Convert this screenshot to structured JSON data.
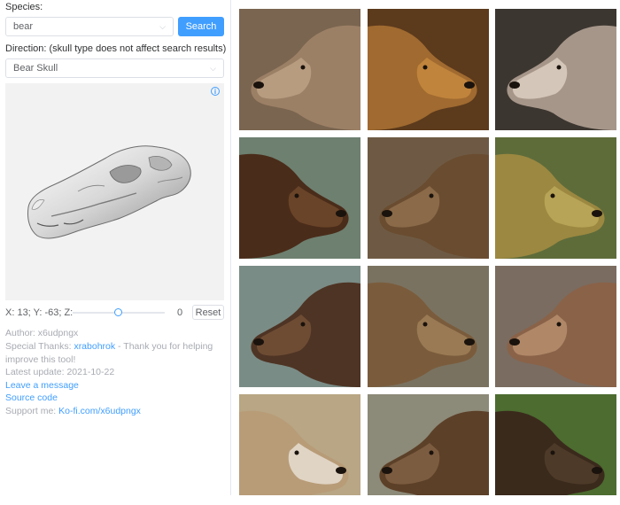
{
  "search": {
    "species_label": "Species:",
    "query_value": "bear",
    "button_label": "Search",
    "direction_label": "Direction: (skull type does not affect search results)",
    "skull_type": "Bear Skull"
  },
  "viewer": {
    "info_icon": "info-icon",
    "coords_text": "X: 13; Y: -63; Z:",
    "z_value": "0",
    "z_fraction": 0.5,
    "reset_label": "Reset"
  },
  "meta": {
    "author": "Author: x6udpngx",
    "thanks_prefix": "Special Thanks: ",
    "thanks_link": "xrabohrok",
    "thanks_suffix": " - Thank you for helping improve this tool!",
    "latest_update": "Latest update: 2021-10-22",
    "leave_message": "Leave a message",
    "source_code": "Source code",
    "support_prefix": "Support me: ",
    "support_link": "Ko-fi.com/x6udpngx"
  },
  "colors": {
    "accent": "#409eff",
    "meta_text": "#a8abb2"
  },
  "results": [
    {
      "name": "bear-photo-1",
      "bg": "#7a6550",
      "fur": "#9c8066",
      "face": "#b89c80"
    },
    {
      "name": "bear-photo-2",
      "bg": "#5c3a1c",
      "fur": "#a06a30",
      "face": "#c0843c"
    },
    {
      "name": "bear-photo-3",
      "bg": "#3c3630",
      "fur": "#a6968a",
      "face": "#d4c6b8"
    },
    {
      "name": "bear-photo-4",
      "bg": "#6e8070",
      "fur": "#4a2c1a",
      "face": "#6a4428"
    },
    {
      "name": "bear-photo-5",
      "bg": "#6e5a44",
      "fur": "#6a4c30",
      "face": "#8a6a48"
    },
    {
      "name": "bear-photo-6",
      "bg": "#5e6c3a",
      "fur": "#9c8840",
      "face": "#b8a456"
    },
    {
      "name": "bear-photo-7",
      "bg": "#7a8c86",
      "fur": "#4e3424",
      "face": "#6e4c34"
    },
    {
      "name": "bear-photo-8",
      "bg": "#7a7260",
      "fur": "#7a5c3c",
      "face": "#9a7a54"
    },
    {
      "name": "bear-photo-9",
      "bg": "#7a6c60",
      "fur": "#8a6248",
      "face": "#b08868"
    },
    {
      "name": "bear-photo-10",
      "bg": "#b8a684",
      "fur": "#b89c78",
      "face": "#e0d4c4"
    },
    {
      "name": "bear-photo-11",
      "bg": "#8c8a78",
      "fur": "#5c4028",
      "face": "#7c5c40"
    },
    {
      "name": "bear-photo-12",
      "bg": "#4c6c30",
      "fur": "#3a2a1c",
      "face": "#4e3a28"
    }
  ]
}
